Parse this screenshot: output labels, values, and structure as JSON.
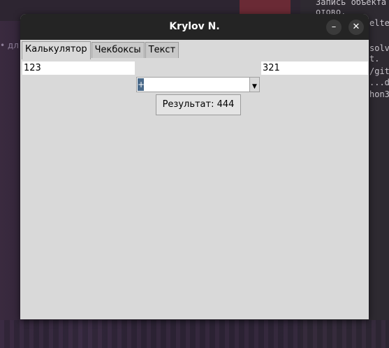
{
  "window": {
    "title": "Krylov N.",
    "minimize_glyph": "–",
    "close_glyph": "✕"
  },
  "tabs": [
    {
      "label": "Калькулятор",
      "active": true
    },
    {
      "label": "Чекбоксы",
      "active": false
    },
    {
      "label": "Текст",
      "active": false
    }
  ],
  "calculator": {
    "first_value": "123",
    "second_value": "321",
    "operator_selected": "+",
    "result_label": "Результат: 444"
  },
  "icons": {
    "minimize": "minimize-icon",
    "close": "close-icon",
    "dropdown": "chevron-down-icon"
  },
  "background": {
    "terminal_lines": [
      "Запись объекта",
      "отово.",
      "elte",
      "solv",
      "t.",
      "/git",
      "...de",
      "hon3"
    ],
    "side_text": "• дл"
  }
}
